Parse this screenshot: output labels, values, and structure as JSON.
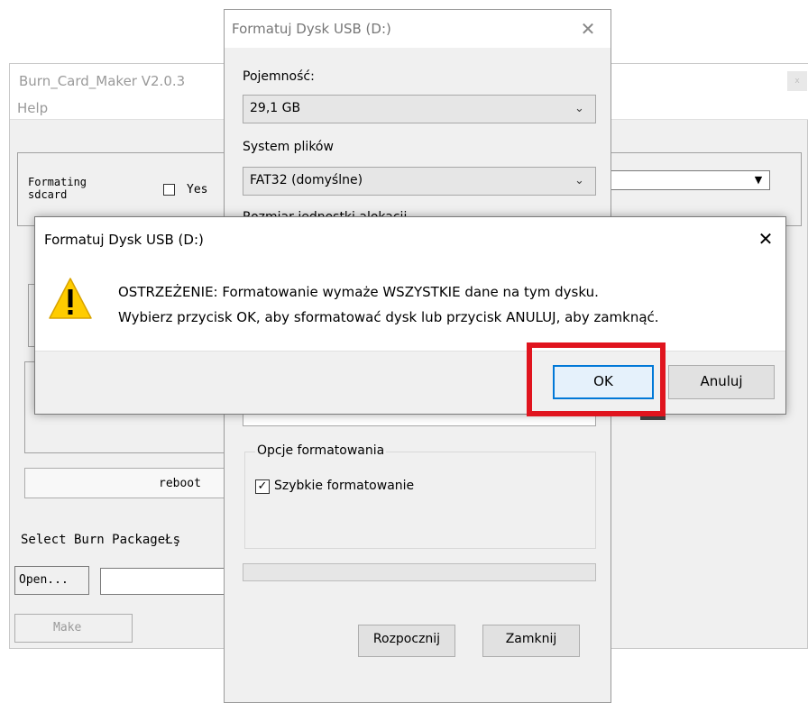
{
  "burn_card_maker": {
    "title": "Burn_Card_Maker V2.0.3",
    "close_glyph": "x",
    "menu_help": "Help",
    "formatting_label": "Formating\nsdcard",
    "yes_label": "Yes",
    "combo_arrow": "▼",
    "reboot_label": "reboot",
    "select_burn_label": "Select Burn PackageŁş",
    "open_label": "Open...",
    "make_label": "Make"
  },
  "format_dialog": {
    "title": "Formatuj Dysk USB (D:)",
    "close_glyph": "✕",
    "capacity_label": "Pojemność:",
    "capacity_value": "29,1 GB",
    "filesystem_label": "System plików",
    "filesystem_value": "FAT32 (domyślne)",
    "allocation_label": "Rozmiar jednostki alokacji",
    "dropdown_glyph": "⌄",
    "options_legend": "Opcje formatowania",
    "quick_format_label": "Szybkie formatowanie",
    "quick_format_checked": true,
    "check_glyph": "✓",
    "start_label": "Rozpocznij",
    "close_button_label": "Zamknij"
  },
  "warning_dialog": {
    "title": "Formatuj Dysk USB (D:)",
    "close_glyph": "✕",
    "icon": "warning-triangle-icon",
    "line1": "OSTRZEŻENIE: Formatowanie wymaże WSZYSTKIE dane na tym dysku.",
    "line2": "Wybierz przycisk OK, aby sformatować dysk lub przycisk ANULUJ, aby zamknąć.",
    "ok_label": "OK",
    "cancel_label": "Anuluj"
  },
  "colors": {
    "highlight": "#e0141e",
    "warning_icon_fill": "#ffcc00",
    "ok_focus_border": "#0078d7"
  }
}
